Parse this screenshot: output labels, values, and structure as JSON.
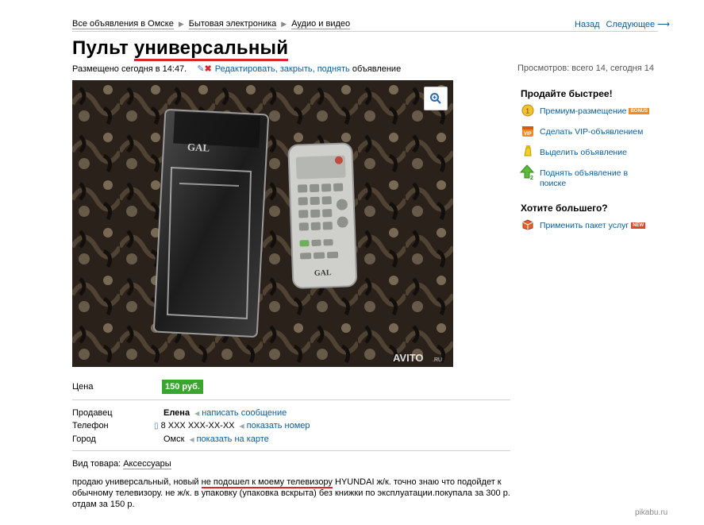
{
  "breadcrumb": {
    "items": [
      "Все объявления в Омске",
      "Бытовая электроника",
      "Аудио и видео"
    ]
  },
  "topnav": {
    "back": "Назад",
    "next": "Следующее ⟶"
  },
  "title": {
    "word1": "Пульт",
    "word2": "универсальный"
  },
  "posted": {
    "text": "Размещено сегодня в 14:47.",
    "edit_links": "Редактировать, закрыть, поднять",
    "suffix": "объявление"
  },
  "views": "Просмотров: всего 14, сегодня 14",
  "photo": {
    "brand": "GAL",
    "watermark": "AVITO",
    "watermark_suffix": ".RU"
  },
  "sidebar": {
    "sell_faster_title": "Продайте быстрее!",
    "premium": "Премиум-размещение",
    "premium_badge": "BONUS",
    "vip": "Сделать VIP-объявлением",
    "highlight": "Выделить объявление",
    "raise_line1": "Поднять объявление в",
    "raise_line2": "поиске",
    "want_more_title": "Хотите большего?",
    "package": "Применить пакет услуг",
    "package_badge": "NEW"
  },
  "info": {
    "price_label": "Цена",
    "price_value": "150 руб.",
    "seller_label": "Продавец",
    "seller_name": "Елена",
    "seller_link": "написать сообщение",
    "phone_label": "Телефон",
    "phone_value": "8 XXX XXX-XX-XX",
    "phone_link": "показать номер",
    "city_label": "Город",
    "city_value": "Омск",
    "city_link": "показать на карте"
  },
  "product_type": {
    "label": "Вид товара:",
    "value": "Аксессуары"
  },
  "description": {
    "part1": "продаю универсальный, новый ",
    "underlined": "не подошел к моему телевизору",
    "part2": " HYUNDAI ж/к. точно знаю что подойдет к обычному телевизору. не ж/к. в упаковку (упаковка вскрыта) без книжки по эксплуатации.покупала за 300 р. отдам за 150 р."
  },
  "site_watermark": "pikabu.ru",
  "colors": {
    "link": "#0a5c9a",
    "price_green": "#3aa52d",
    "underline_red": "#d8262b"
  }
}
